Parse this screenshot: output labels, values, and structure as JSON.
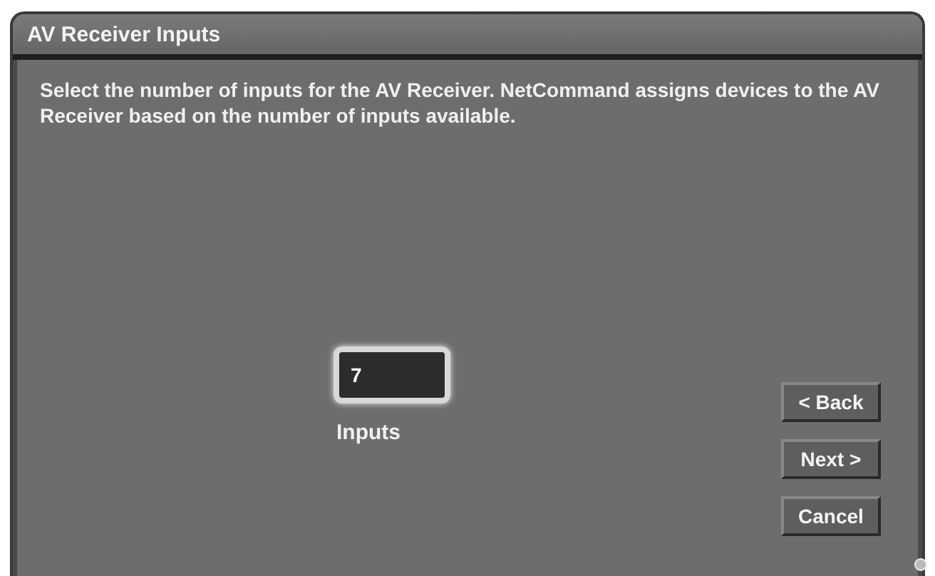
{
  "window": {
    "title": "AV Receiver Inputs"
  },
  "instructions": "Select the number of inputs for the AV Receiver.  NetCommand assigns devices to the AV Receiver based on the number of inputs available.",
  "inputs_field": {
    "value": "7",
    "label": "Inputs"
  },
  "buttons": [
    {
      "label": "< Back"
    },
    {
      "label": "Next >"
    },
    {
      "label": "Cancel"
    }
  ]
}
